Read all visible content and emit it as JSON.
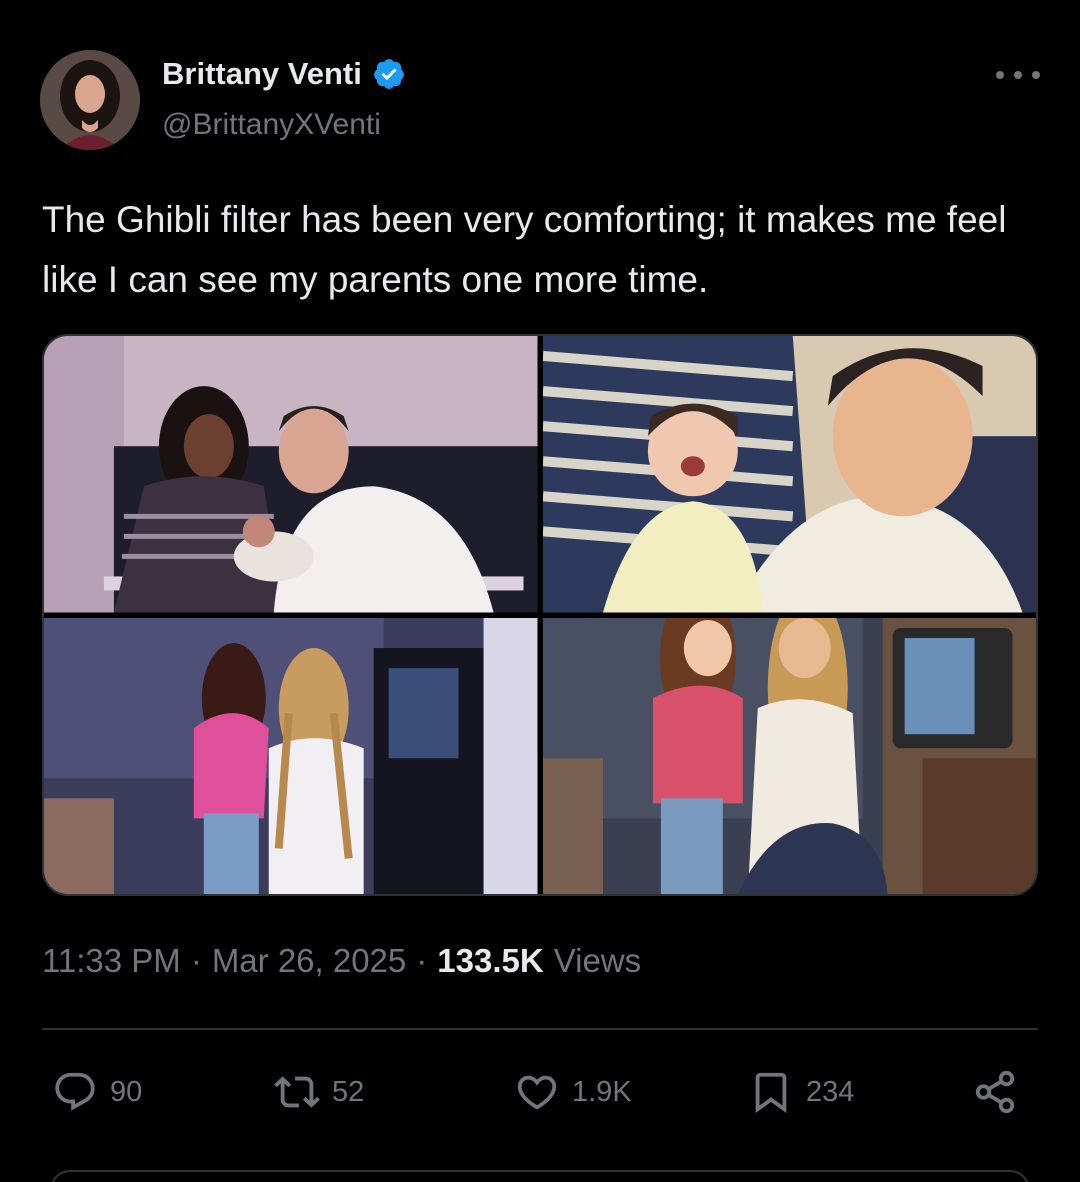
{
  "author": {
    "display_name": "Brittany Venti",
    "handle": "@BrittanyXVenti",
    "verified_icon": "verified-badge-icon",
    "avatar_icon": "avatar"
  },
  "tweet": {
    "text": "The Ghibli filter has been very comforting; it makes me feel like I can see my parents one more time.",
    "photos": [
      "photo-family-original",
      "photo-family-ghibli",
      "photo-girls-original",
      "photo-girls-ghibli"
    ]
  },
  "meta": {
    "time": "11:33 PM",
    "sep1": "·",
    "date": "Mar 26, 2025",
    "sep2": "·",
    "views_count": "133.5K",
    "views_label": "Views"
  },
  "actions": {
    "replies": "90",
    "reposts": "52",
    "likes": "1.9K",
    "bookmarks": "234"
  },
  "colors": {
    "background": "#000000",
    "text_primary": "#e7e9ea",
    "text_secondary": "#71767b",
    "verified": "#1d9bf0",
    "border": "#2f3336"
  }
}
